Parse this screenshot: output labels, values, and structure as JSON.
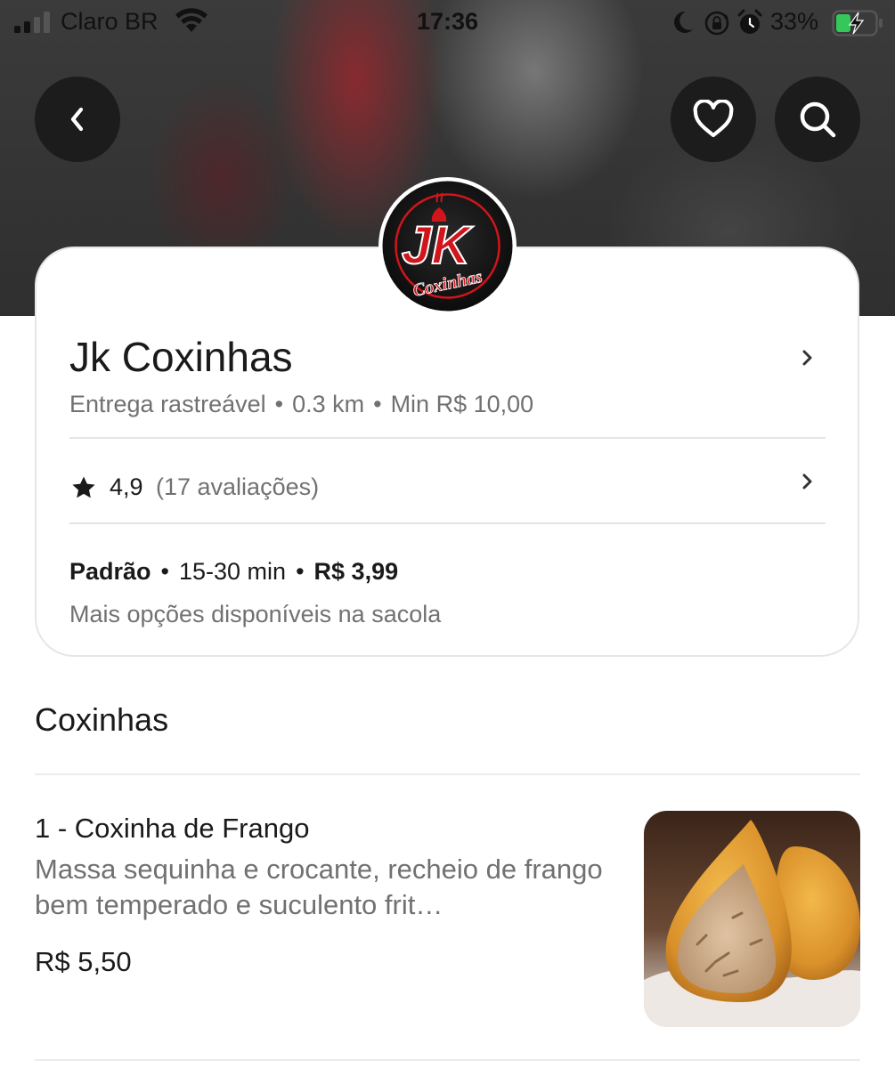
{
  "status_bar": {
    "carrier": "Claro BR",
    "time": "17:36",
    "battery": "33%",
    "icons": [
      "signal-icon",
      "wifi-icon",
      "moon-icon",
      "rotation-lock-icon",
      "alarm-icon",
      "battery-charging-icon"
    ]
  },
  "header": {
    "back_icon": "chevron-left-icon",
    "favorite_icon": "heart-icon",
    "search_icon": "search-icon"
  },
  "store": {
    "logo_text": "JK",
    "logo_subtext": "Coxinhas",
    "name": "Jk Coxinhas",
    "delivery_type": "Entrega rastreável",
    "distance": "0.3 km",
    "minimum": "Min R$ 10,00",
    "rating": "4,9",
    "reviews": "(17 avaliações)",
    "rating_fill": 0.98
  },
  "delivery_option": {
    "label": "Padrão",
    "time": "15-30 min",
    "fee": "R$ 3,99",
    "note": "Mais opções disponíveis na sacola"
  },
  "menu": {
    "section_title": "Coxinhas",
    "items": [
      {
        "name": "1 - Coxinha de Frango",
        "description": "Massa sequinha e crocante, recheio de frango bem temperado e suculento frit…",
        "price": "R$ 5,50"
      }
    ]
  },
  "colors": {
    "brand_red": "#d0151c",
    "text_primary": "#1a1a1a",
    "text_secondary": "#717171",
    "button_bg": "#1c1c1c",
    "battery_green": "#34c759"
  }
}
